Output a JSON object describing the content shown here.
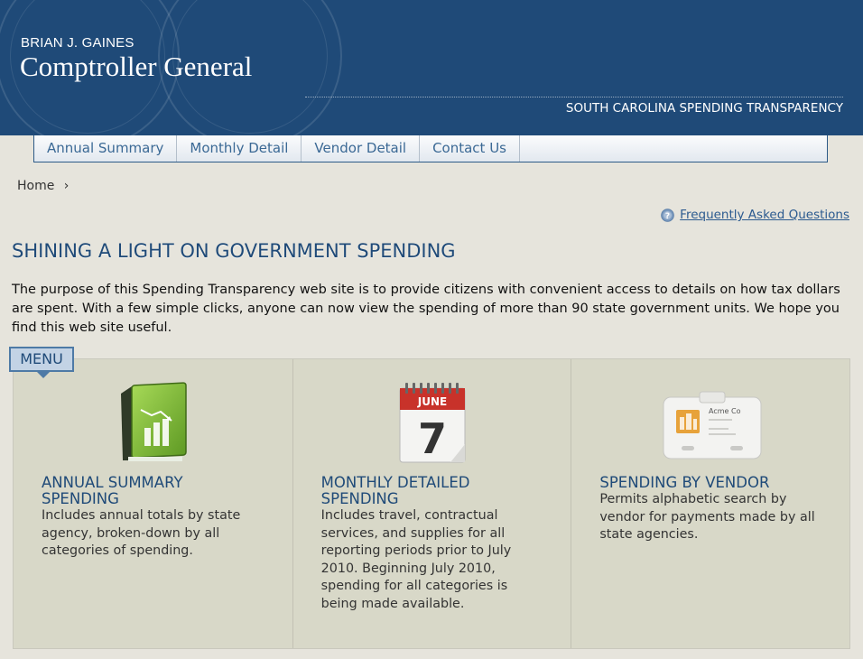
{
  "header": {
    "name": "BRIAN J. GAINES",
    "title": "Comptroller General",
    "subtitle": "SOUTH CAROLINA SPENDING TRANSPARENCY"
  },
  "nav": {
    "items": [
      "Annual Summary",
      "Monthly Detail",
      "Vendor Detail",
      "Contact Us"
    ]
  },
  "breadcrumb": {
    "home": "Home",
    "separator": "›"
  },
  "faq": {
    "label": "Frequently Asked Questions"
  },
  "page": {
    "title": "SHINING A LIGHT ON GOVERNMENT SPENDING",
    "intro": "The purpose of this Spending Transparency web site is to provide citizens with convenient access to details on how tax dollars are spent. With a few simple clicks, anyone can now view the spending of more than 90 state government units. We hope you find this web site useful."
  },
  "menu": {
    "tab_label": "MENU",
    "cards": [
      {
        "icon": "green-book-chart-icon",
        "heading_line1": "ANNUAL SUMMARY",
        "heading_line2": "SPENDING",
        "text": "Includes annual totals by state agency, broken-down by all categories of spending."
      },
      {
        "icon": "calendar-icon",
        "calendar_month": "JUNE",
        "calendar_day": "7",
        "heading_line1": "MONTHLY DETAILED",
        "heading_line2": "SPENDING",
        "text": "Includes travel, contractual services, and supplies for all reporting periods prior to July 2010. Beginning July 2010, spending for all categories is being made available."
      },
      {
        "icon": "id-badge-icon",
        "badge_company": "Acme Co",
        "heading_line1": "SPENDING BY VENDOR",
        "heading_line2": "",
        "text": "Permits alphabetic search by vendor for payments made by all state agencies."
      }
    ]
  },
  "colors": {
    "header_bg": "#1f4a78",
    "link": "#2b5a8f",
    "page_bg": "#e6e4dc",
    "panel_bg": "#d8d8c8"
  }
}
